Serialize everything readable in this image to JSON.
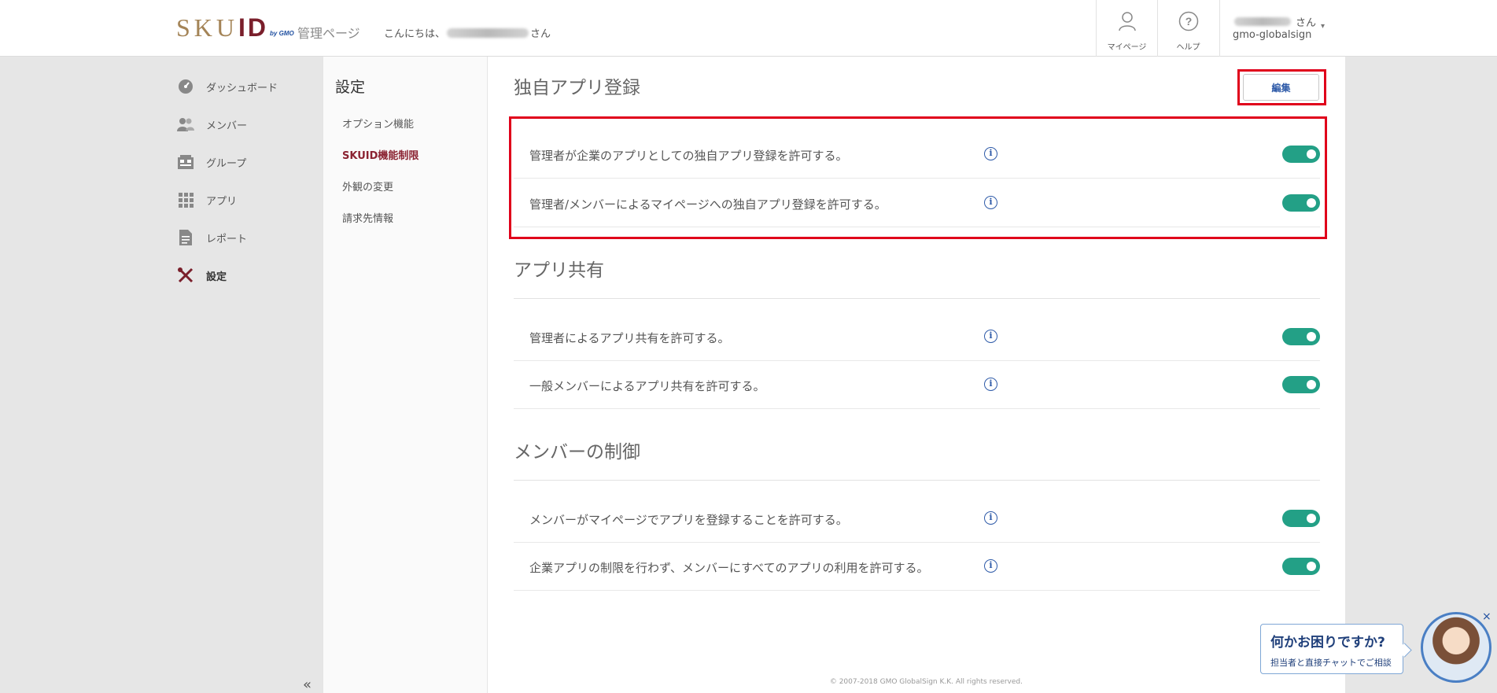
{
  "header": {
    "logo": {
      "sku": "SKU",
      "id": "ID",
      "by": "by GMO"
    },
    "admin_title": "管理ページ",
    "greeting_prefix": "こんにちは、",
    "greeting_suffix": "さん",
    "mypage_label": "マイページ",
    "help_label": "ヘルプ",
    "user_suffix": "さん",
    "user_org": "gmo-globalsign",
    "caret": "▾"
  },
  "sidebar": {
    "items": [
      {
        "label": "ダッシュボード",
        "icon": "dashboard-icon"
      },
      {
        "label": "メンバー",
        "icon": "members-icon"
      },
      {
        "label": "グループ",
        "icon": "group-icon"
      },
      {
        "label": "アプリ",
        "icon": "apps-grid-icon"
      },
      {
        "label": "レポート",
        "icon": "report-icon"
      },
      {
        "label": "設定",
        "icon": "settings-tools-icon"
      }
    ],
    "collapse": "«"
  },
  "subnav": {
    "title": "設定",
    "items": [
      "オプション機能",
      "SKUID機能制限",
      "外観の変更",
      "請求先情報"
    ]
  },
  "main": {
    "edit_label": "編集",
    "info_glyph": "i",
    "sections": [
      {
        "title": "独自アプリ登録",
        "rows": [
          "管理者が企業のアプリとしての独自アプリ登録を許可する。",
          "管理者/メンバーによるマイページへの独自アプリ登録を許可する。"
        ]
      },
      {
        "title": "アプリ共有",
        "rows": [
          "管理者によるアプリ共有を許可する。",
          "一般メンバーによるアプリ共有を許可する。"
        ]
      },
      {
        "title": "メンバーの制御",
        "rows": [
          "メンバーがマイページでアプリを登録することを許可する。",
          "企業アプリの制限を行わず、メンバーにすべてのアプリの利用を許可する。"
        ]
      }
    ],
    "footer": "© 2007-2018 GMO GlobalSign K.K. All rights reserved."
  },
  "chat": {
    "question": "何かお困りですか?",
    "sub": "担当者と直接チャットでご相談",
    "close": "×"
  },
  "colors": {
    "brand_gold": "#a48457",
    "brand_red": "#7a1f2b",
    "toggle_on": "#23a086",
    "highlight": "#e0001b",
    "info_blue": "#2e5aa8"
  }
}
